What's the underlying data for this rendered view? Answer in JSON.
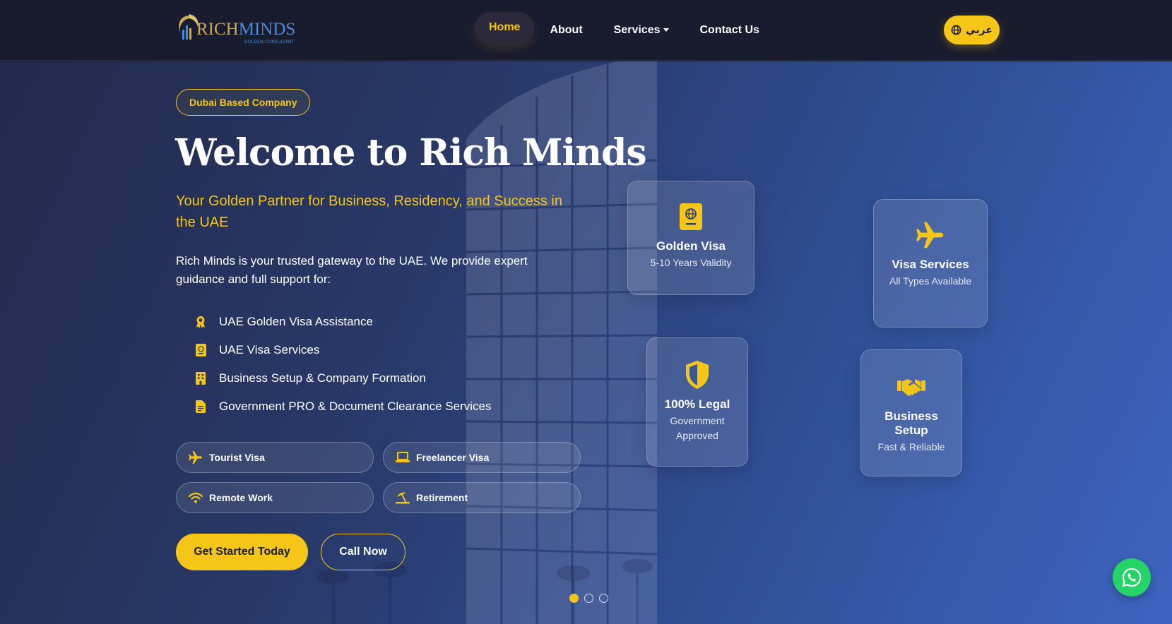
{
  "brand": {
    "logo_text_a": "RICH",
    "logo_text_b": "MINDS",
    "logo_sub": "GOLDEN CONSULTANT"
  },
  "nav": {
    "items": [
      {
        "label": "Home",
        "active": true
      },
      {
        "label": "About"
      },
      {
        "label": "Services",
        "dropdown": true
      },
      {
        "label": "Contact Us"
      }
    ],
    "lang_button": "عربي",
    "lang_icon": "globe-icon"
  },
  "hero": {
    "badge": "Dubai Based Company",
    "title": "Welcome to Rich Minds",
    "subtitle": "Your Golden Partner for Business, Residency, and Success in the UAE",
    "description": "Rich Minds is your trusted gateway to the UAE. We provide expert guidance and full support for:",
    "features": [
      {
        "label": "UAE Golden Visa Assistance",
        "icon": "award-icon"
      },
      {
        "label": "UAE Visa Services",
        "icon": "passport-icon"
      },
      {
        "label": "Business Setup & Company Formation",
        "icon": "building-icon"
      },
      {
        "label": "Government PRO & Document Clearance Services",
        "icon": "document-icon"
      }
    ],
    "pills": [
      {
        "label": "Tourist Visa",
        "icon": "plane-icon"
      },
      {
        "label": "Freelancer Visa",
        "icon": "laptop-icon"
      },
      {
        "label": "Remote Work",
        "icon": "wifi-icon"
      },
      {
        "label": "Retirement",
        "icon": "umbrella-beach-icon"
      }
    ],
    "cta_primary": "Get Started Today",
    "cta_secondary": "Call Now"
  },
  "cards": [
    {
      "title": "Golden Visa",
      "sub": "5-10 Years Validity",
      "icon": "passport-icon"
    },
    {
      "title": "Visa Services",
      "sub": "All Types Available",
      "icon": "plane-icon"
    },
    {
      "title": "100% Legal",
      "sub": "Government Approved",
      "icon": "shield-icon"
    },
    {
      "title": "Business Setup",
      "sub": "Fast & Reliable",
      "icon": "handshake-icon"
    }
  ],
  "carousel": {
    "slides": 3,
    "active_index": 0
  },
  "colors": {
    "accent": "#f5c518",
    "nav_bg": "#191b2e",
    "hero_start": "#232a4a",
    "hero_end": "#3d64c0",
    "whatsapp": "#25d366"
  }
}
